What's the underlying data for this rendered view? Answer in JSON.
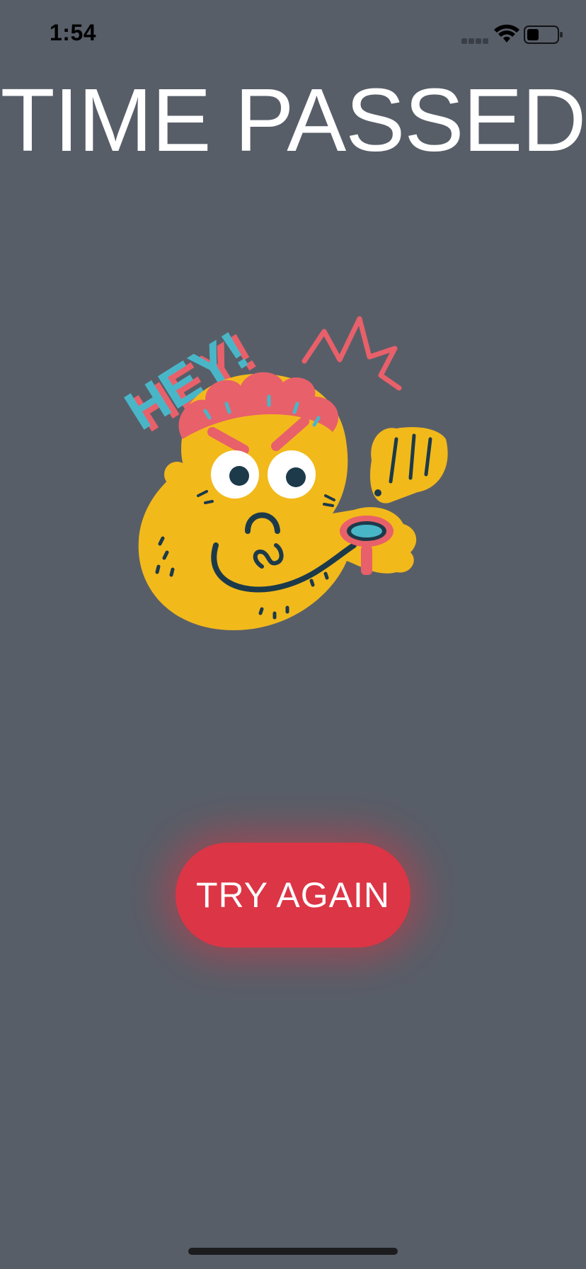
{
  "status_bar": {
    "time": "1:54",
    "icons": [
      "signal-icon",
      "wifi-icon",
      "battery-icon"
    ]
  },
  "title": "TIME PASSED",
  "sticker": {
    "icon": "angry-character-sticker",
    "text": "HEY!"
  },
  "button": {
    "label": "TRY AGAIN"
  },
  "colors": {
    "background": "#585e68",
    "button": "#dc3545",
    "character": "#f2b91b",
    "accent_pink": "#e8606a",
    "accent_blue": "#49b6c8",
    "outline": "#1c3a4a"
  }
}
